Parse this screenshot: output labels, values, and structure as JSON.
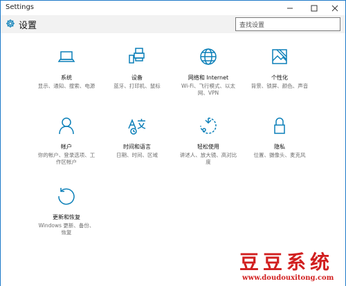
{
  "window": {
    "title": "Settings"
  },
  "header": {
    "title": "设置",
    "search_placeholder": "查找设置"
  },
  "items": [
    {
      "name": "系统",
      "desc": "显示、通知、搜索、电源"
    },
    {
      "name": "设备",
      "desc": "蓝牙、打印机、鼠标"
    },
    {
      "name": "网络和 Internet",
      "desc": "Wi-Fi、飞行模式、以太网、VPN"
    },
    {
      "name": "个性化",
      "desc": "背景、锁屏、颜色、声音"
    },
    {
      "name": "帐户",
      "desc": "你的帐户、登录选项、工作区帐户"
    },
    {
      "name": "时间和语言",
      "desc": "日期、时间、区域"
    },
    {
      "name": "轻松使用",
      "desc": "讲述人、放大镜、高对比度"
    },
    {
      "name": "隐私",
      "desc": "位置、摄像头、麦克风"
    },
    {
      "name": "更新和恢复",
      "desc": "Windows 更新、备份、恢复"
    }
  ],
  "watermark": {
    "text": "豆豆系统",
    "url": "www.doudouxitong.com"
  },
  "colors": {
    "accent": "#0a7fb8",
    "window_border": "#1b78c8",
    "watermark": "#d11f1f"
  }
}
